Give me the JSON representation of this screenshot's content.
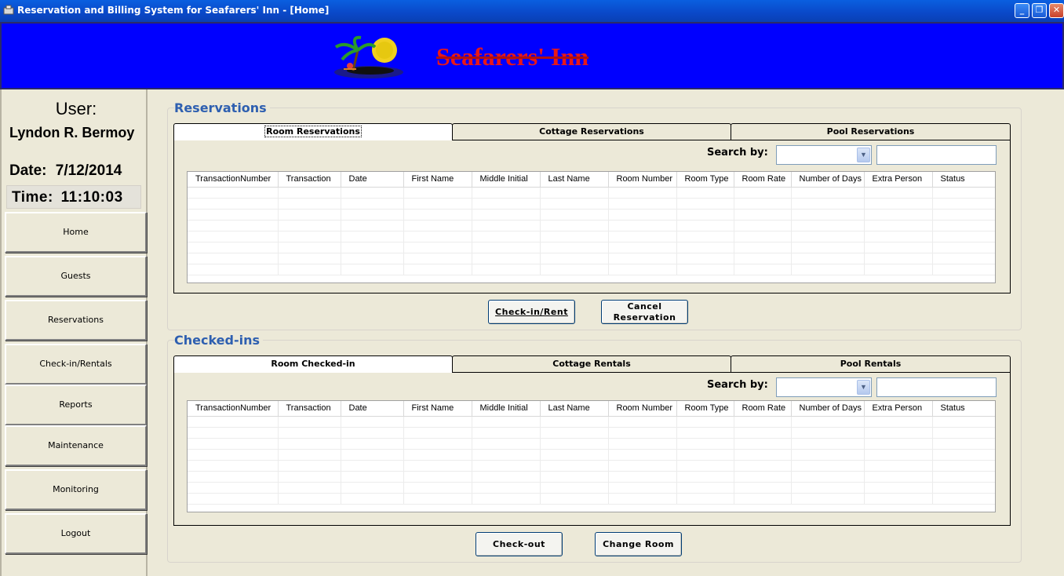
{
  "window": {
    "title": "Reservation and Billing System for Seafarers' Inn - [Home]",
    "controls": [
      "minimize-icon",
      "restore-icon",
      "close-icon"
    ]
  },
  "banner": {
    "brand": "Seafarers' Inn",
    "logo_icon": "palm-island-logo"
  },
  "sidebar": {
    "user_label": "User:",
    "user_name": "Lyndon R. Bermoy",
    "date_label": "Date:",
    "date_value": "7/12/2014",
    "time_label": "Time:",
    "time_value": "11:10:03",
    "nav": [
      "Home",
      "Guests",
      "Reservations",
      "Check-in/Rentals",
      "Reports",
      "Maintenance",
      "Monitoring",
      "Logout"
    ]
  },
  "reservations": {
    "title": "Reservations",
    "tabs": [
      "Room Reservations",
      "Cottage Reservations",
      "Pool Reservations"
    ],
    "active_tab": 0,
    "search_label": "Search by:",
    "search_value": "",
    "search_option": "",
    "columns": [
      "TransactionNumber",
      "Transaction",
      "Date",
      "First Name",
      "Middle Initial",
      "Last Name",
      "Room Number",
      "Room Type",
      "Room Rate",
      "Number of Days",
      "Extra Person",
      "Status"
    ],
    "rows": [],
    "buttons": {
      "checkin": "Check-in/Rent",
      "cancel": "Cancel Reservation"
    }
  },
  "checkedins": {
    "title": "Checked-ins",
    "tabs": [
      "Room Checked-in",
      "Cottage Rentals",
      "Pool Rentals"
    ],
    "active_tab": 0,
    "search_label": "Search by:",
    "search_value": "",
    "search_option": "",
    "columns": [
      "TransactionNumber",
      "Transaction",
      "Date",
      "First Name",
      "Middle Initial",
      "Last Name",
      "Room Number",
      "Room Type",
      "Room Rate",
      "Number of Days",
      "Extra Person",
      "Status"
    ],
    "rows": [],
    "buttons": {
      "checkout": "Check-out",
      "change_room": "Change Room"
    }
  }
}
